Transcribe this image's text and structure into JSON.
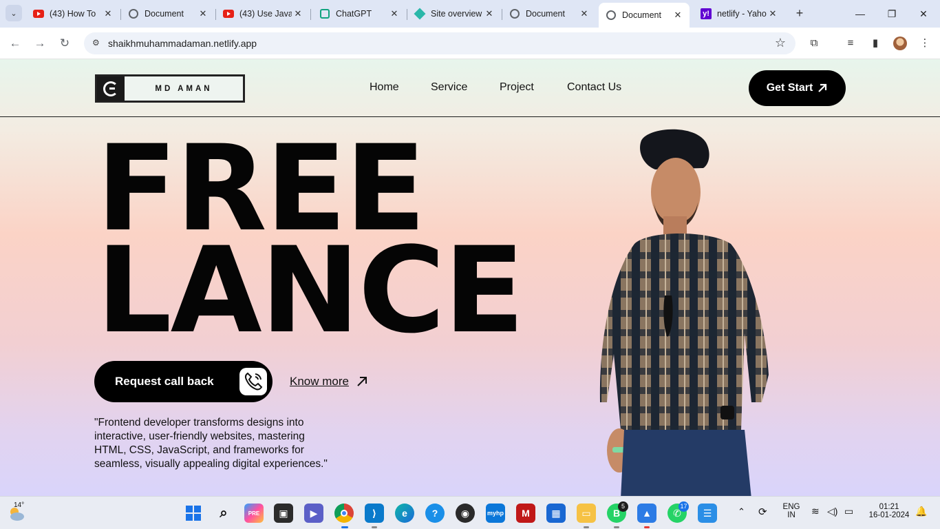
{
  "browser": {
    "tabs": [
      {
        "title": "(43) How To",
        "icon": "youtube-icon"
      },
      {
        "title": "Document",
        "icon": "globe-icon"
      },
      {
        "title": "(43) Use Java",
        "icon": "youtube-icon"
      },
      {
        "title": "ChatGPT",
        "icon": "chatgpt-icon"
      },
      {
        "title": "Site overview",
        "icon": "netlify-icon"
      },
      {
        "title": "Document",
        "icon": "globe-icon"
      },
      {
        "title": "Document",
        "icon": "globe-icon",
        "active": true
      },
      {
        "title": "netlify - Yahoo",
        "icon": "yahoo-icon"
      }
    ],
    "url": "shaikhmuhammadaman.netlify.app"
  },
  "site": {
    "logo_text": "MD AMAN",
    "nav": [
      "Home",
      "Service",
      "Project",
      "Contact Us"
    ],
    "cta_top": "Get Start",
    "hero_line1": "FREE",
    "hero_line2": "LANCE",
    "request_btn": "Request call back",
    "know_more": "Know more",
    "description": "\"Frontend developer transforms designs into interactive, user-friendly websites, mastering HTML, CSS, JavaScript, and frameworks for seamless, visually appealing digital experiences.\""
  },
  "taskbar": {
    "weather_temp": "14°",
    "badges": {
      "whatsapp_business": "5",
      "whatsapp": "17"
    },
    "language": "ENG",
    "region": "IN",
    "time": "01:21",
    "date": "16-01-2024"
  },
  "colors": {
    "accent": "#000000",
    "page_top": "#e7f5ec",
    "page_mid": "#fbd3c6",
    "page_bottom": "#d9d4fb"
  }
}
